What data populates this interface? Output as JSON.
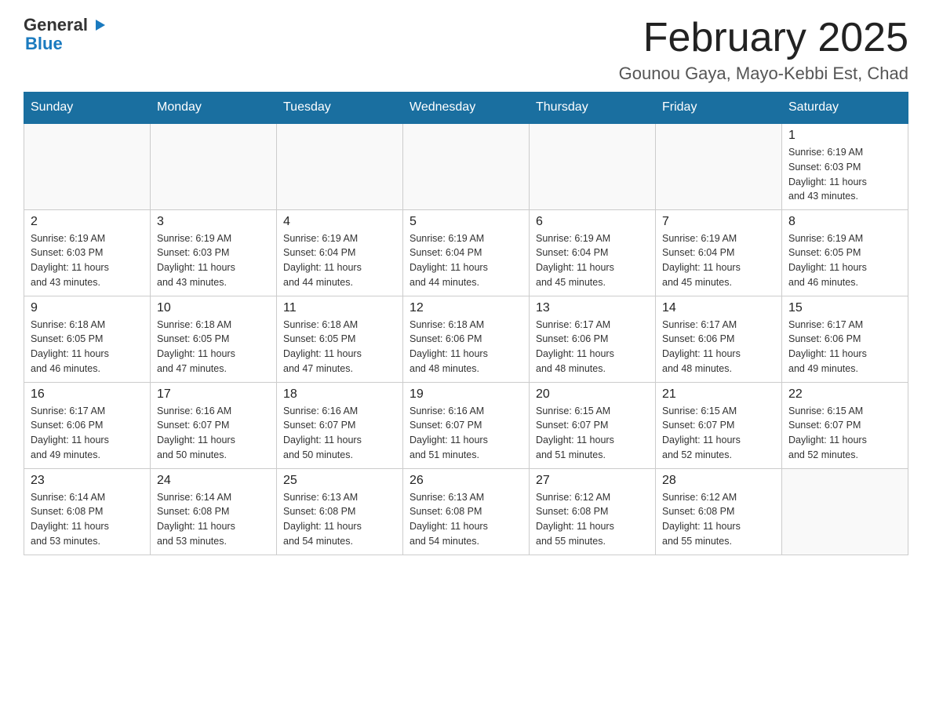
{
  "logo": {
    "text_general": "General",
    "text_blue": "Blue"
  },
  "title": "February 2025",
  "subtitle": "Gounou Gaya, Mayo-Kebbi Est, Chad",
  "days_header": [
    "Sunday",
    "Monday",
    "Tuesday",
    "Wednesday",
    "Thursday",
    "Friday",
    "Saturday"
  ],
  "weeks": [
    [
      {
        "day": "",
        "info": ""
      },
      {
        "day": "",
        "info": ""
      },
      {
        "day": "",
        "info": ""
      },
      {
        "day": "",
        "info": ""
      },
      {
        "day": "",
        "info": ""
      },
      {
        "day": "",
        "info": ""
      },
      {
        "day": "1",
        "info": "Sunrise: 6:19 AM\nSunset: 6:03 PM\nDaylight: 11 hours\nand 43 minutes."
      }
    ],
    [
      {
        "day": "2",
        "info": "Sunrise: 6:19 AM\nSunset: 6:03 PM\nDaylight: 11 hours\nand 43 minutes."
      },
      {
        "day": "3",
        "info": "Sunrise: 6:19 AM\nSunset: 6:03 PM\nDaylight: 11 hours\nand 43 minutes."
      },
      {
        "day": "4",
        "info": "Sunrise: 6:19 AM\nSunset: 6:04 PM\nDaylight: 11 hours\nand 44 minutes."
      },
      {
        "day": "5",
        "info": "Sunrise: 6:19 AM\nSunset: 6:04 PM\nDaylight: 11 hours\nand 44 minutes."
      },
      {
        "day": "6",
        "info": "Sunrise: 6:19 AM\nSunset: 6:04 PM\nDaylight: 11 hours\nand 45 minutes."
      },
      {
        "day": "7",
        "info": "Sunrise: 6:19 AM\nSunset: 6:04 PM\nDaylight: 11 hours\nand 45 minutes."
      },
      {
        "day": "8",
        "info": "Sunrise: 6:19 AM\nSunset: 6:05 PM\nDaylight: 11 hours\nand 46 minutes."
      }
    ],
    [
      {
        "day": "9",
        "info": "Sunrise: 6:18 AM\nSunset: 6:05 PM\nDaylight: 11 hours\nand 46 minutes."
      },
      {
        "day": "10",
        "info": "Sunrise: 6:18 AM\nSunset: 6:05 PM\nDaylight: 11 hours\nand 47 minutes."
      },
      {
        "day": "11",
        "info": "Sunrise: 6:18 AM\nSunset: 6:05 PM\nDaylight: 11 hours\nand 47 minutes."
      },
      {
        "day": "12",
        "info": "Sunrise: 6:18 AM\nSunset: 6:06 PM\nDaylight: 11 hours\nand 48 minutes."
      },
      {
        "day": "13",
        "info": "Sunrise: 6:17 AM\nSunset: 6:06 PM\nDaylight: 11 hours\nand 48 minutes."
      },
      {
        "day": "14",
        "info": "Sunrise: 6:17 AM\nSunset: 6:06 PM\nDaylight: 11 hours\nand 48 minutes."
      },
      {
        "day": "15",
        "info": "Sunrise: 6:17 AM\nSunset: 6:06 PM\nDaylight: 11 hours\nand 49 minutes."
      }
    ],
    [
      {
        "day": "16",
        "info": "Sunrise: 6:17 AM\nSunset: 6:06 PM\nDaylight: 11 hours\nand 49 minutes."
      },
      {
        "day": "17",
        "info": "Sunrise: 6:16 AM\nSunset: 6:07 PM\nDaylight: 11 hours\nand 50 minutes."
      },
      {
        "day": "18",
        "info": "Sunrise: 6:16 AM\nSunset: 6:07 PM\nDaylight: 11 hours\nand 50 minutes."
      },
      {
        "day": "19",
        "info": "Sunrise: 6:16 AM\nSunset: 6:07 PM\nDaylight: 11 hours\nand 51 minutes."
      },
      {
        "day": "20",
        "info": "Sunrise: 6:15 AM\nSunset: 6:07 PM\nDaylight: 11 hours\nand 51 minutes."
      },
      {
        "day": "21",
        "info": "Sunrise: 6:15 AM\nSunset: 6:07 PM\nDaylight: 11 hours\nand 52 minutes."
      },
      {
        "day": "22",
        "info": "Sunrise: 6:15 AM\nSunset: 6:07 PM\nDaylight: 11 hours\nand 52 minutes."
      }
    ],
    [
      {
        "day": "23",
        "info": "Sunrise: 6:14 AM\nSunset: 6:08 PM\nDaylight: 11 hours\nand 53 minutes."
      },
      {
        "day": "24",
        "info": "Sunrise: 6:14 AM\nSunset: 6:08 PM\nDaylight: 11 hours\nand 53 minutes."
      },
      {
        "day": "25",
        "info": "Sunrise: 6:13 AM\nSunset: 6:08 PM\nDaylight: 11 hours\nand 54 minutes."
      },
      {
        "day": "26",
        "info": "Sunrise: 6:13 AM\nSunset: 6:08 PM\nDaylight: 11 hours\nand 54 minutes."
      },
      {
        "day": "27",
        "info": "Sunrise: 6:12 AM\nSunset: 6:08 PM\nDaylight: 11 hours\nand 55 minutes."
      },
      {
        "day": "28",
        "info": "Sunrise: 6:12 AM\nSunset: 6:08 PM\nDaylight: 11 hours\nand 55 minutes."
      },
      {
        "day": "",
        "info": ""
      }
    ]
  ]
}
